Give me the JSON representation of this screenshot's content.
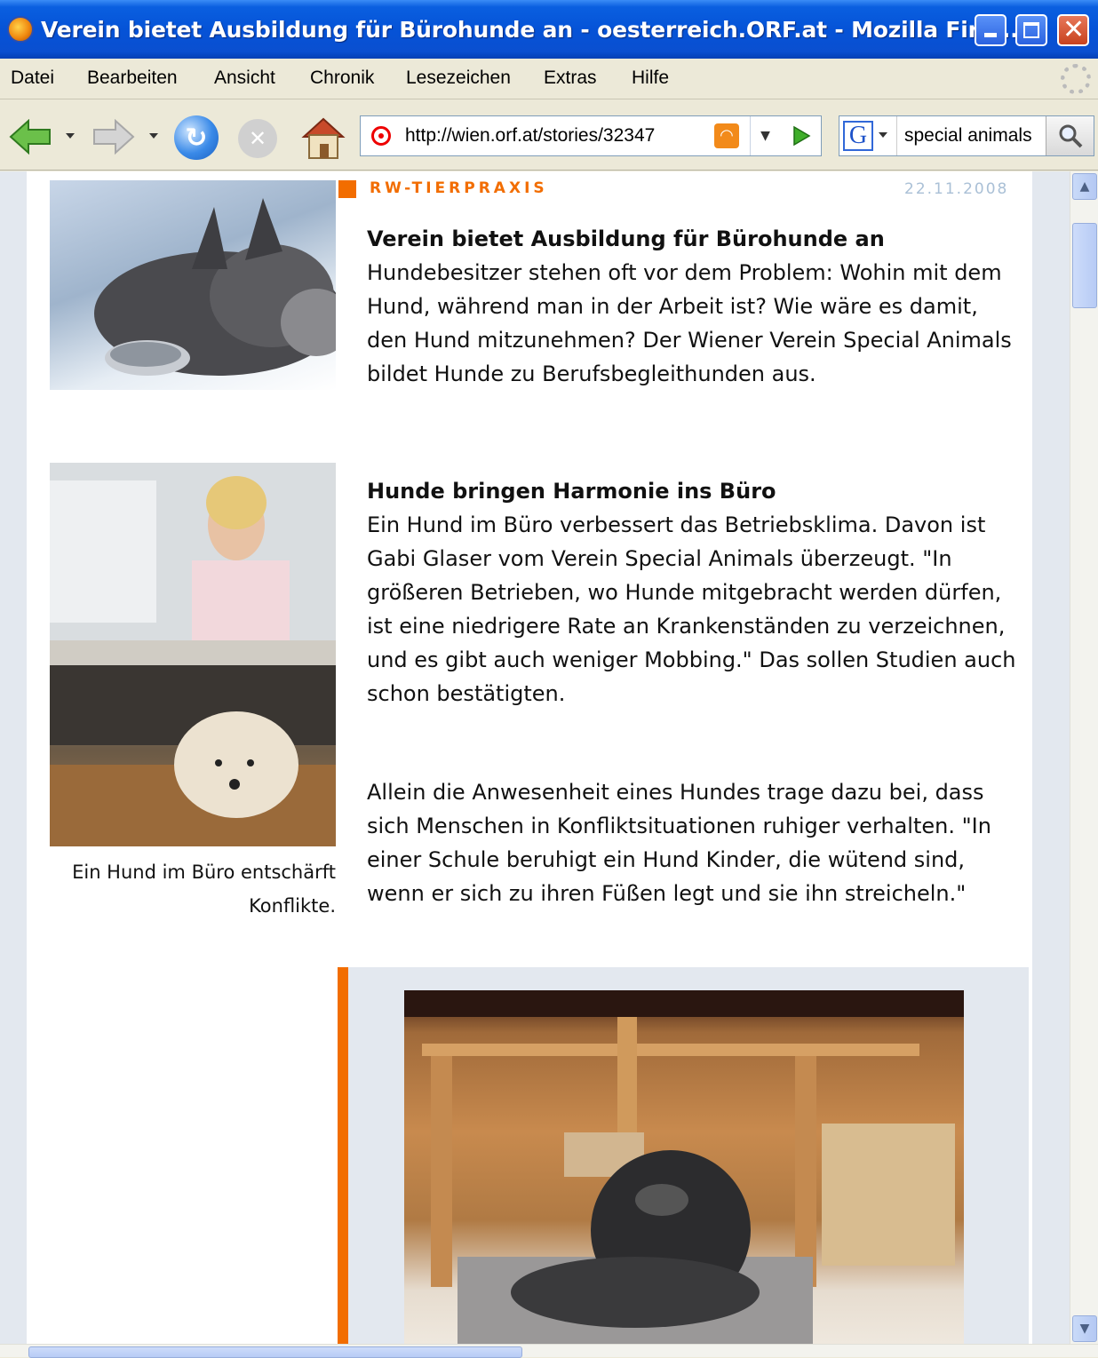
{
  "window": {
    "title": "Verein bietet Ausbildung für Bürohunde an - oesterreich.ORF.at - Mozilla Fire...",
    "close_glyph": "✕"
  },
  "menu": [
    "Datei",
    "Bearbeiten",
    "Ansicht",
    "Chronik",
    "Lesezeichen",
    "Extras",
    "Hilfe"
  ],
  "toolbar": {
    "url": "http://wien.orf.at/stories/32347",
    "search_engine": "G",
    "search_query": "special animals"
  },
  "page": {
    "category": "RW-TIERPRAXIS",
    "date": "22.11.2008",
    "article1": {
      "heading": "Verein bietet Ausbildung für Bürohunde an",
      "body": "Hundebesitzer stehen oft vor dem Problem: Wohin mit dem Hund, während man in der Arbeit ist? Wie wäre es damit, den Hund mitzunehmen? Der Wiener Verein Special Animals bildet Hunde zu Berufsbegleithunden aus."
    },
    "article2": {
      "heading": "Hunde bringen Harmonie ins Büro",
      "body": "Ein Hund im Büro verbessert das Betriebsklima. Davon ist Gabi Glaser vom Verein Special Animals überzeugt. \"In größeren Betrieben, wo Hunde mitgebracht werden dürfen, ist eine niedrigere Rate an Krankenständen zu verzeichnen, und es gibt auch weniger Mobbing.\" Das sollen Studien auch schon bestätigten.",
      "body2": "Allein die Anwesenheit eines Hundes trage dazu bei, dass sich Menschen in Konfliktsituationen ruhiger verhalten. \"In einer Schule beruhigt ein Hund Kinder, die wütend sind, wenn er sich zu ihren Füßen legt und sie ihn streicheln.\""
    },
    "caption": "Ein Hund im Büro entschärft Konflikte."
  },
  "colors": {
    "accent": "#f26d00",
    "date": "#aac0d6",
    "titlebar": "#0553d7"
  },
  "icons": [
    "firefox-icon",
    "back-icon",
    "forward-icon",
    "reload-icon",
    "stop-icon",
    "home-icon",
    "site-icon",
    "rss-icon",
    "go-icon",
    "google-icon",
    "search-icon",
    "throbber-icon"
  ]
}
